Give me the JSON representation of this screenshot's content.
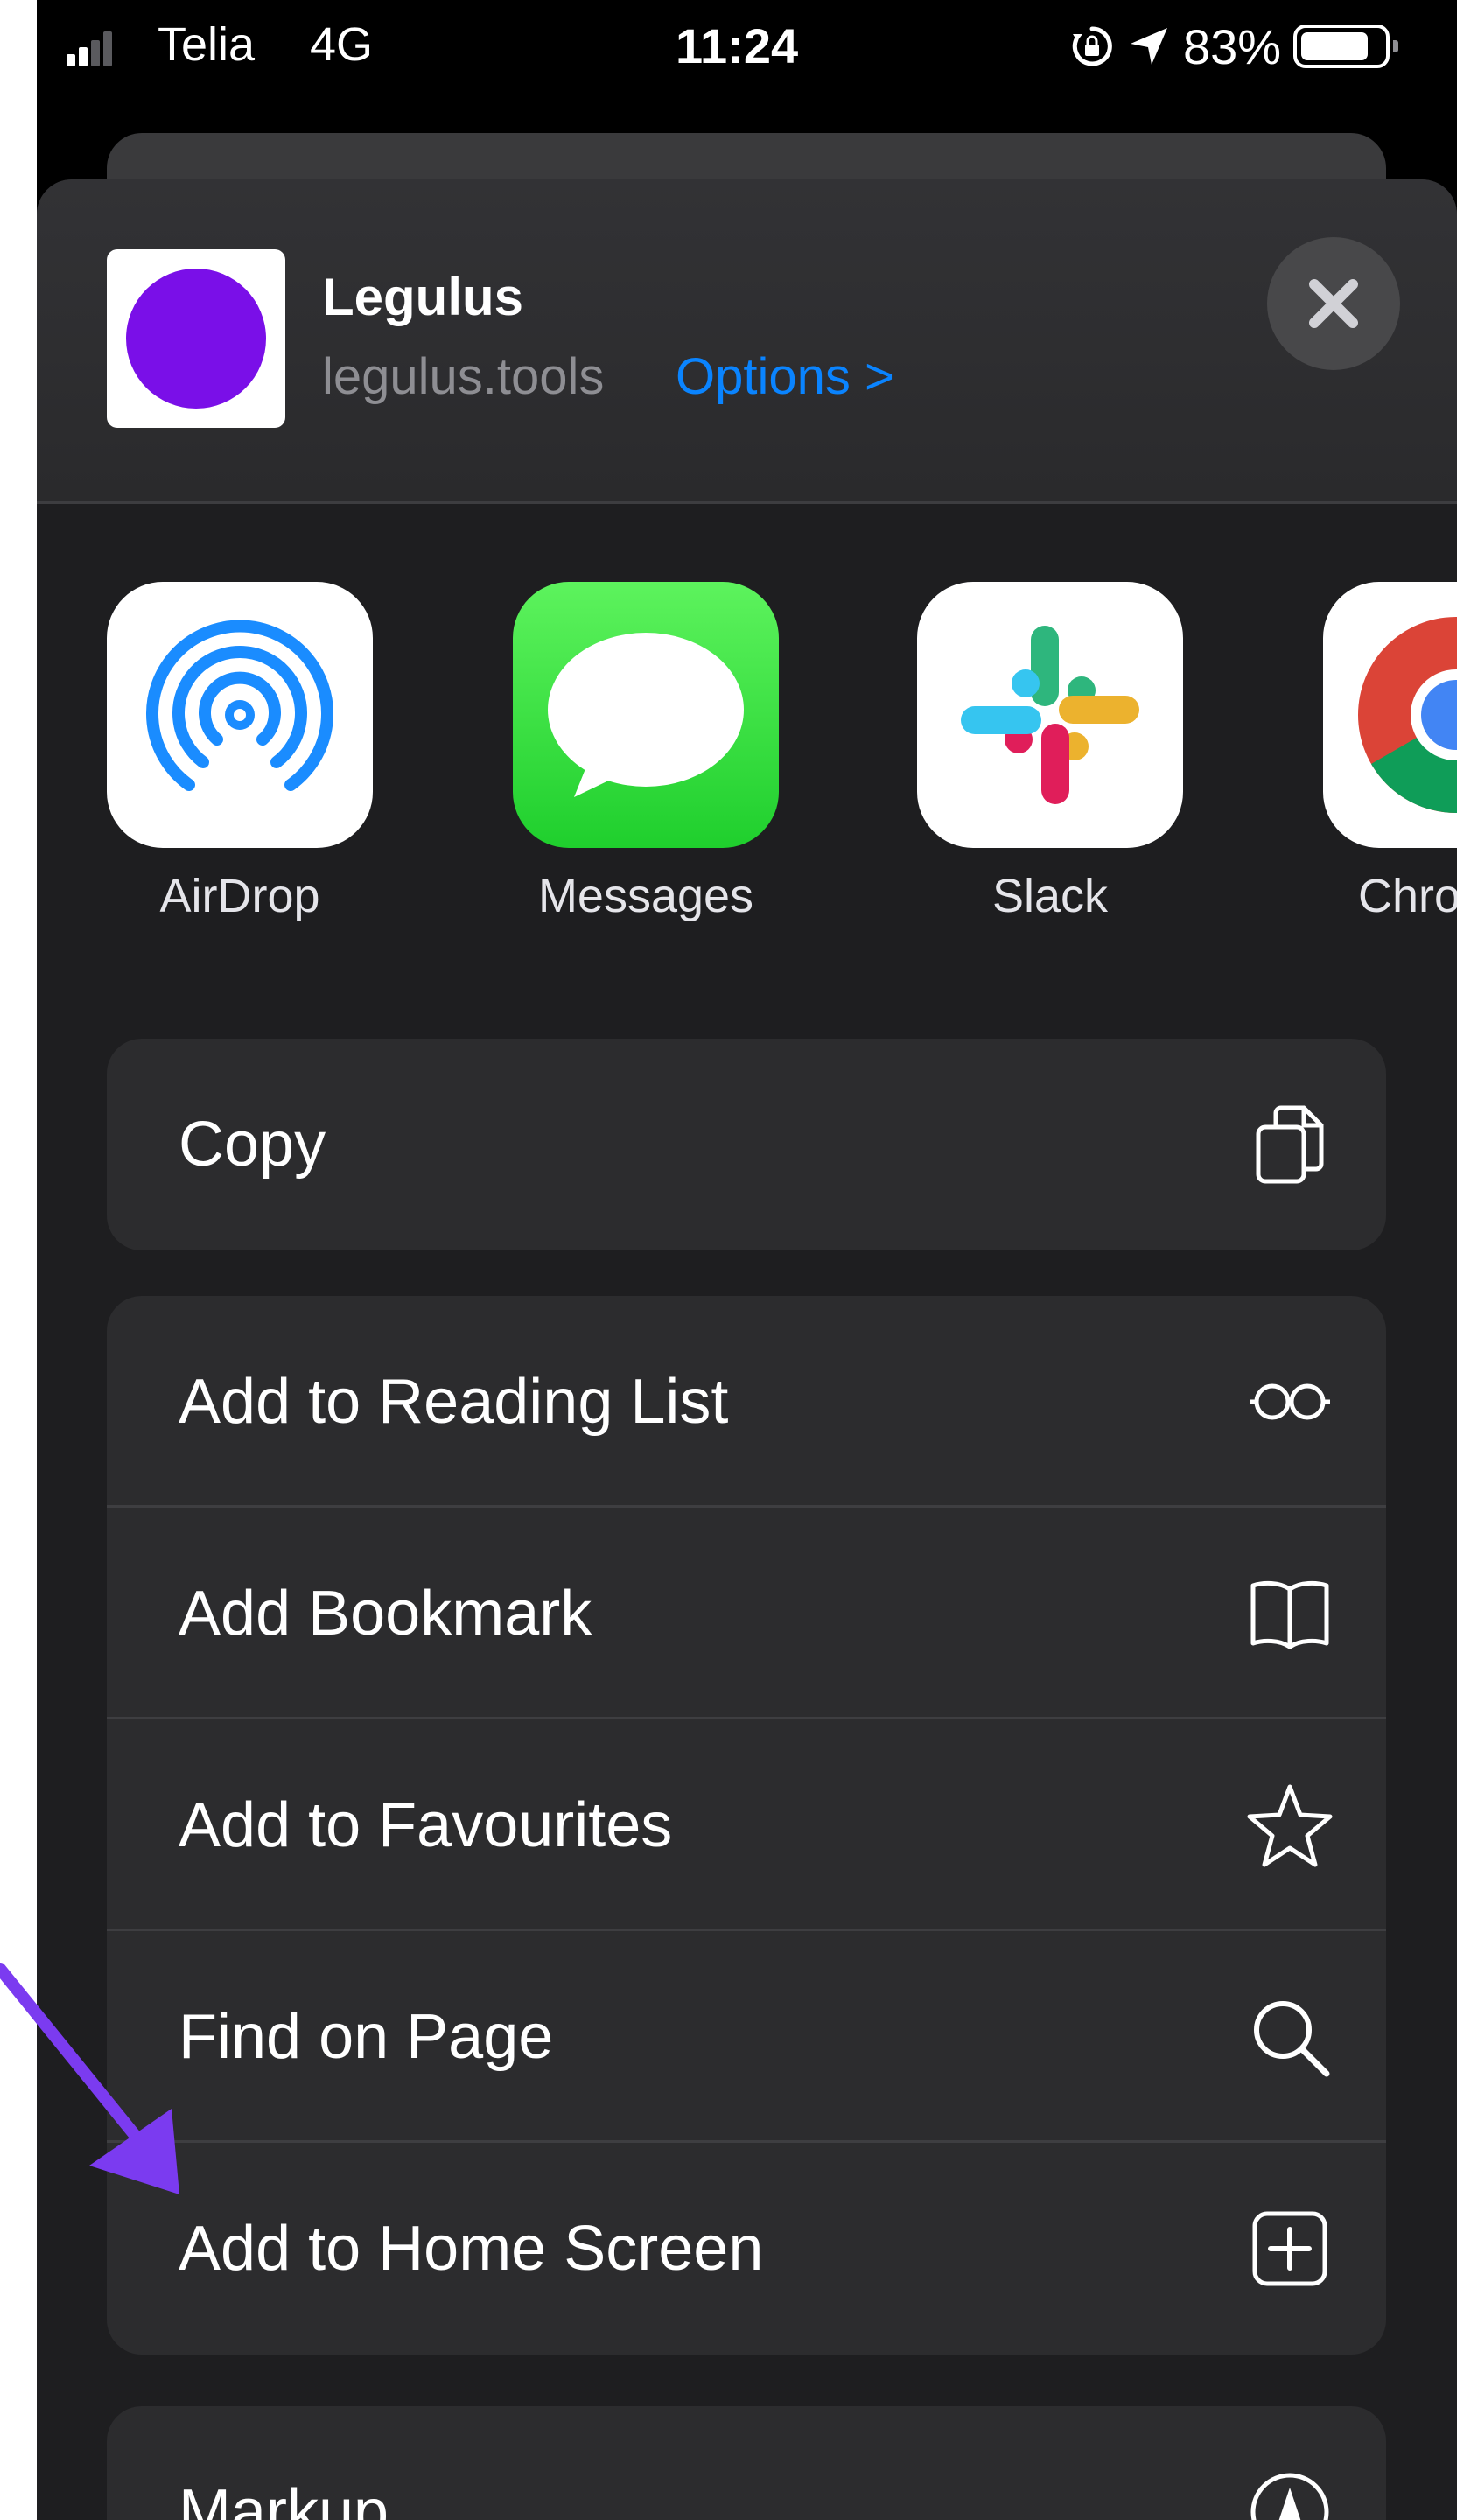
{
  "status_bar": {
    "carrier": "Telia",
    "network": "4G",
    "time": "11:24",
    "battery_percent": "83%",
    "battery_level": 0.83,
    "icons": [
      "cellular-signal-icon",
      "orientation-lock-icon",
      "location-arrow-icon",
      "battery-icon"
    ]
  },
  "share_sheet": {
    "site": {
      "title": "Legulus",
      "url": "legulus.tools",
      "options_label": "Options >",
      "icon_color": "#7a0fe8"
    },
    "close_icon": "close-icon",
    "apps": [
      {
        "label": "AirDrop",
        "icon": "airdrop-icon"
      },
      {
        "label": "Messages",
        "icon": "messages-icon"
      },
      {
        "label": "Slack",
        "icon": "slack-icon"
      },
      {
        "label": "Chro",
        "icon": "chrome-icon"
      }
    ],
    "copy_group": [
      {
        "label": "Copy",
        "icon": "copy-icon"
      }
    ],
    "safari_actions": [
      {
        "label": "Add to Reading List",
        "icon": "reading-glasses-icon"
      },
      {
        "label": "Add Bookmark",
        "icon": "book-icon"
      },
      {
        "label": "Add to Favourites",
        "icon": "star-icon"
      },
      {
        "label": "Find on Page",
        "icon": "magnifying-glass-icon"
      },
      {
        "label": "Add to Home Screen",
        "icon": "plus-square-icon"
      }
    ],
    "more_actions": [
      {
        "label": "Markup",
        "icon": "markup-pen-icon"
      }
    ]
  },
  "annotation": {
    "arrow_color": "#7b3bf0",
    "points_to": "Add to Home Screen"
  },
  "colors": {
    "accent_link": "#0a84ff",
    "sheet_background": "#1e1e20",
    "row_background": "#2c2c2e"
  }
}
